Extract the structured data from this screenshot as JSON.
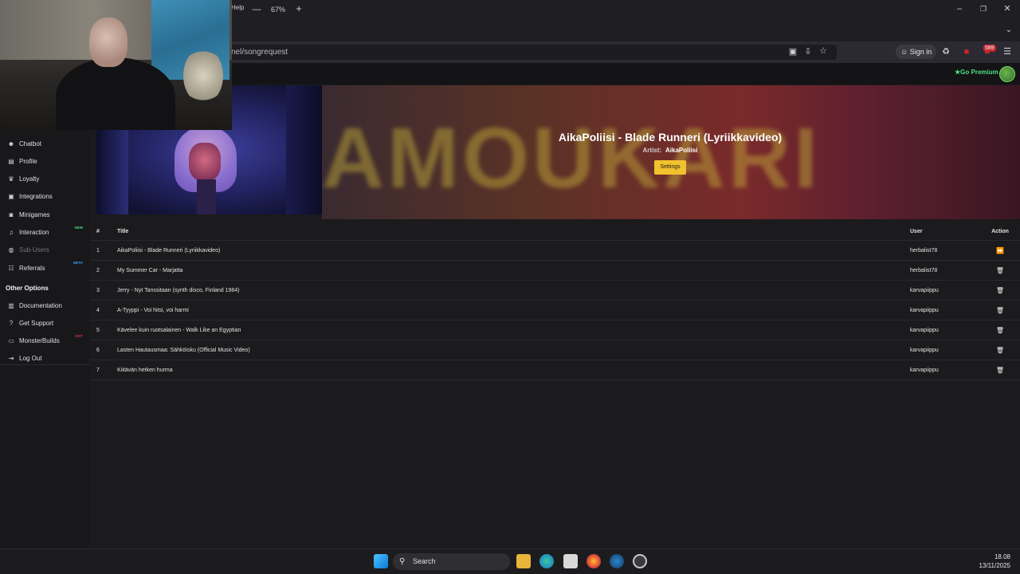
{
  "browser": {
    "menu_partial": "Help",
    "zoom": "67%",
    "zoom_out": "—",
    "zoom_in": "+",
    "url": "nel/songrequest",
    "sign_in": "Sign in",
    "notif_badge": "589"
  },
  "site": {
    "go_premium": "Go Premium"
  },
  "sidebar": {
    "items": [
      {
        "label": "Chatbot",
        "icon": "robot-icon",
        "glyph": "☻"
      },
      {
        "label": "Profile",
        "icon": "profile-icon",
        "glyph": "▤"
      },
      {
        "label": "Loyalty",
        "icon": "trophy-icon",
        "glyph": "♛"
      },
      {
        "label": "Integrations",
        "icon": "puzzle-icon",
        "glyph": "▣"
      },
      {
        "label": "Minigames",
        "icon": "gamepad-icon",
        "glyph": "◙"
      },
      {
        "label": "Interaction",
        "icon": "music-icon",
        "glyph": "♫",
        "tag": "NEW",
        "tag_color": "#3ddc84"
      },
      {
        "label": "Sub-Users",
        "icon": "users-icon",
        "glyph": "◍",
        "disabled": true
      },
      {
        "label": "Referrals",
        "icon": "referral-icon",
        "glyph": "☷",
        "tag": "BETA",
        "tag_color": "#3aa0ff"
      }
    ],
    "other_options_heading": "Other Options",
    "other_items": [
      {
        "label": "Documentation",
        "icon": "book-icon",
        "glyph": "▥"
      },
      {
        "label": "Get Support",
        "icon": "question-icon",
        "glyph": "?"
      },
      {
        "label": "MonsterBuilds",
        "icon": "laptop-icon",
        "glyph": "▭",
        "tag": "HOT",
        "tag_color": "#e0344a"
      },
      {
        "label": "Log Out",
        "icon": "logout-icon",
        "glyph": "⇥"
      }
    ]
  },
  "now_playing": {
    "title": "AikaPoliisi - Blade Runneri (Lyriikkavideo)",
    "artist_label": "Artist:",
    "artist": "AikaPoliisi",
    "settings": "Settings",
    "banner_text": "AMOUKARI"
  },
  "queue": {
    "headers": {
      "num": "#",
      "title": "Title",
      "user": "User",
      "action": "Action"
    },
    "rows": [
      {
        "num": "1",
        "title": "AikaPoliisi - Blade Runneri (Lyriikkavideo)",
        "user": "herbalist78",
        "action": "skip-icon"
      },
      {
        "num": "2",
        "title": "My Summer Car - Marjatta",
        "user": "herbalist78",
        "action": "trash-icon"
      },
      {
        "num": "3",
        "title": "Jerry - Nyt Tanssitaan (synth disco, Finland 1984)",
        "user": "karvapiippu",
        "action": "trash-icon"
      },
      {
        "num": "4",
        "title": "A-Tyyppi - Voi hitsi, voi harmi",
        "user": "karvapiippu",
        "action": "trash-icon"
      },
      {
        "num": "5",
        "title": "Käveleе kuin ruotsalainen - Walk Like an Egyptian",
        "user": "karvapiippu",
        "action": "trash-icon"
      },
      {
        "num": "6",
        "title": "Lasten Hautausmaa: Sähköisku (Official Music Video)",
        "user": "karvapiippu",
        "action": "trash-icon"
      },
      {
        "num": "7",
        "title": "Kiitävän hetken hurma",
        "user": "karvapiippu",
        "action": "trash-icon"
      }
    ]
  },
  "taskbar": {
    "search_placeholder": "Search",
    "time": "18.08",
    "date": "13/11/2025"
  }
}
